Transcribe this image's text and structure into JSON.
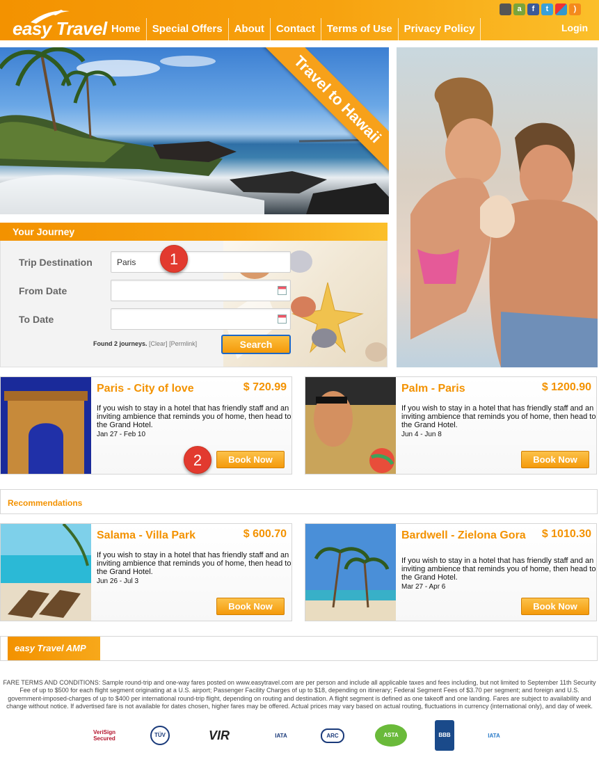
{
  "header": {
    "logo_text": "easy Travel",
    "nav": [
      "Home",
      "Special Offers",
      "About",
      "Contact",
      "Terms of Use",
      "Privacy Policy"
    ],
    "login_label": "Login",
    "social_icons": [
      "apple-icon",
      "android-icon",
      "facebook-icon",
      "twitter-icon",
      "delicious-icon",
      "rss-icon"
    ]
  },
  "hero": {
    "ribbon_text": "Travel to Hawaii"
  },
  "journey": {
    "title": "Your Journey",
    "destination_label": "Trip Destination",
    "destination_value": "Paris",
    "from_label": "From Date",
    "to_label": "To Date",
    "found_text": "Found 2 journeys.",
    "clear_link": "[Clear]",
    "permlink": "[Permlink]",
    "search_label": "Search"
  },
  "badges": [
    "1",
    "2"
  ],
  "offers": [
    {
      "title": "Paris - City of love",
      "price": "$ 720.99",
      "desc": "If you wish to stay in a hotel that has friendly staff and an inviting ambience that reminds you of home, then head to the Grand Hotel.",
      "dates": "Jan 27 - Feb 10",
      "button": "Book Now"
    },
    {
      "title": "Palm - Paris",
      "price": "$ 1200.90",
      "desc": "If you wish to stay in a hotel that has friendly staff and an inviting ambience that reminds you of home, then head to the Grand Hotel.",
      "dates": "Jun 4 - Jun 8",
      "button": "Book Now"
    }
  ],
  "recommendations_title": "Recommendations",
  "recommendations": [
    {
      "title": "Salama - Villa Park",
      "price": "$ 600.70",
      "desc": "If you wish to stay in a hotel that has friendly staff and an inviting ambience that reminds you of home, then head to the Grand Hotel.",
      "dates": "Jun 26 - Jul 3",
      "button": "Book Now"
    },
    {
      "title": "Bardwell - Zielona Gora",
      "price": "$ 1010.30",
      "desc": "If you wish to stay in a hotel that has friendly staff and an inviting ambience that reminds you of home, then head to the Grand Hotel.",
      "dates": "Mar 27 - Apr 6",
      "button": "Book Now"
    }
  ],
  "amp_logo": "easy Travel AMP",
  "fare_terms": "FARE TERMS AND CONDITIONS: Sample round-trip and one-way fares posted on www.easytravel.com are per person and include all applicable taxes and fees including, but not limited to September 11th Security Fee of up to $500 for each flight segment originating at a U.S. airport; Passenger Facility Charges of up to $18, depending on itinerary; Federal Segment Fees of $3.70 per segment; and foreign and U.S. government-imposed-charges of up to $400 per international round-trip flight, depending on routing and destination. A flight segment is defined as one takeoff and one landing. Fares are subject to availability and change without notice. If advertised fare is not available for dates chosen, higher fares may be offered. Actual prices may vary based on actual routing, fluctuations in currency (international only), and day of week.",
  "trust_logos": [
    "VeriSign Secured",
    "TÜV",
    "VIR",
    "IATA",
    "ARC",
    "ASTA",
    "BBB",
    "IATA"
  ]
}
